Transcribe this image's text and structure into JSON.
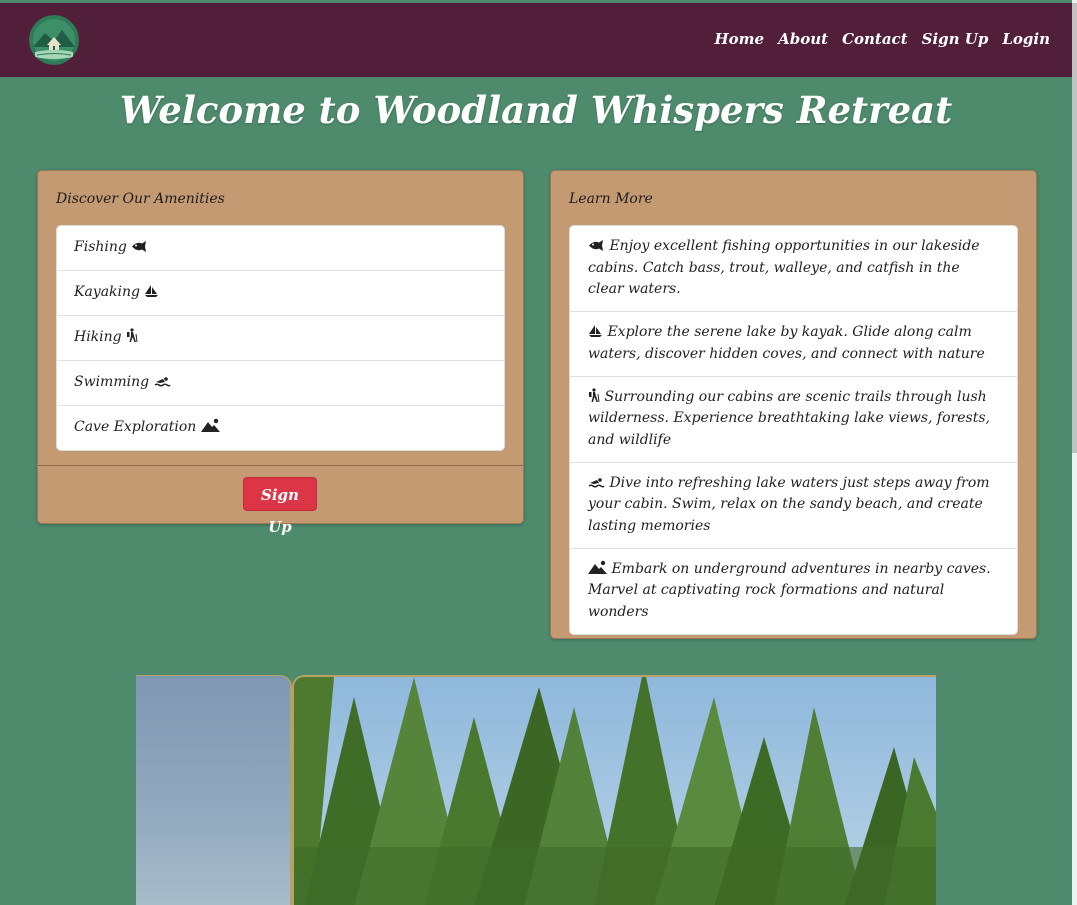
{
  "nav": {
    "logo_alt": "Woodland Whispers logo",
    "links": [
      "Home",
      "About",
      "Contact",
      "Sign Up",
      "Login"
    ]
  },
  "page": {
    "title": "Welcome to Woodland Whispers Retreat"
  },
  "amenities": {
    "header": "Discover Our Amenities",
    "items": [
      {
        "label": "Fishing",
        "icon": "fish-icon"
      },
      {
        "label": "Kayaking",
        "icon": "sailboat-icon"
      },
      {
        "label": "Hiking",
        "icon": "hiker-icon"
      },
      {
        "label": "Swimming",
        "icon": "swimmer-icon"
      },
      {
        "label": "Cave Exploration",
        "icon": "mountain-sun-icon"
      }
    ],
    "signup_label": "Sign Up"
  },
  "learn_more": {
    "header": "Learn More",
    "items": [
      {
        "icon": "fish-icon",
        "text": "Enjoy excellent fishing opportunities in our lakeside cabins. Catch bass, trout, walleye, and catfish in the clear waters."
      },
      {
        "icon": "sailboat-icon",
        "text": "Explore the serene lake by kayak. Glide along calm waters, discover hidden coves, and connect with nature"
      },
      {
        "icon": "hiker-icon",
        "text": "Surrounding our cabins are scenic trails through lush wilderness. Experience breathtaking lake views, forests, and wildlife"
      },
      {
        "icon": "swimmer-icon",
        "text": "Dive into refreshing lake waters just steps away from your cabin. Swim, relax on the sandy beach, and create lasting memories"
      },
      {
        "icon": "mountain-sun-icon",
        "text": "Embark on underground adventures in nearby caves. Marvel at captivating rock formations and natural wonders"
      }
    ]
  },
  "colors": {
    "navbar": "#521f3b",
    "background": "#4e8b6d",
    "card": "#c49a72",
    "button": "#dc3545"
  }
}
